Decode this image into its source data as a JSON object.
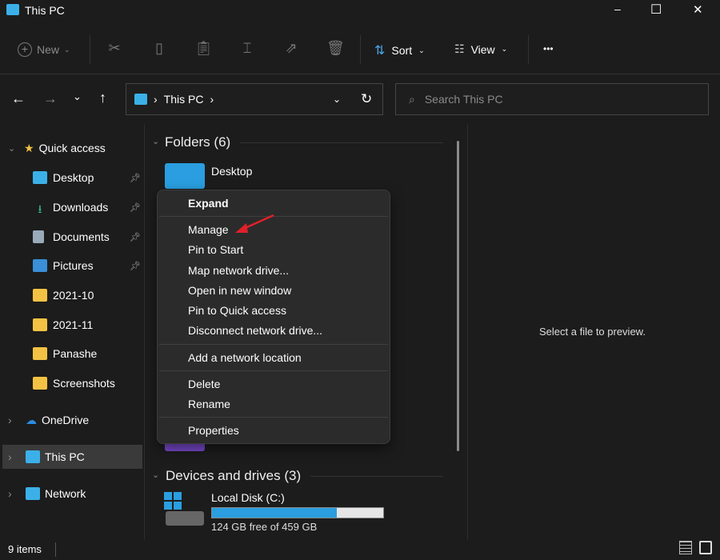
{
  "window": {
    "title": "This PC",
    "minimize": "–",
    "maximize": "☐",
    "close": "✕"
  },
  "toolbar": {
    "new": "New",
    "sort": "Sort",
    "view": "View",
    "more": "•••"
  },
  "address": {
    "path": "This PC",
    "search_placeholder": "Search This PC"
  },
  "sidebar": {
    "items": [
      {
        "label": "Quick access"
      },
      {
        "label": "Desktop"
      },
      {
        "label": "Downloads"
      },
      {
        "label": "Documents"
      },
      {
        "label": "Pictures"
      },
      {
        "label": "2021-10"
      },
      {
        "label": "2021-11"
      },
      {
        "label": "Panashe"
      },
      {
        "label": "Screenshots"
      },
      {
        "label": "OneDrive"
      },
      {
        "label": "This PC"
      },
      {
        "label": "Network"
      }
    ]
  },
  "content": {
    "folders_header": "Folders (6)",
    "first_folder": "Desktop",
    "devices_header": "Devices and drives (3)",
    "drive": {
      "name": "Local Disk (C:)",
      "free": "124 GB free of 459 GB",
      "used_fraction": 0.73
    }
  },
  "context_menu": {
    "items": [
      "Expand",
      "Manage",
      "Pin to Start",
      "Map network drive...",
      "Open in new window",
      "Pin to Quick access",
      "Disconnect network drive...",
      "Add a network location",
      "Delete",
      "Rename",
      "Properties"
    ]
  },
  "preview": {
    "text": "Select a file to preview."
  },
  "status": {
    "count": "9 items"
  },
  "colors": {
    "accent": "#2a9ee0",
    "arrow": "#e0202a",
    "folder": "#f3c244"
  }
}
